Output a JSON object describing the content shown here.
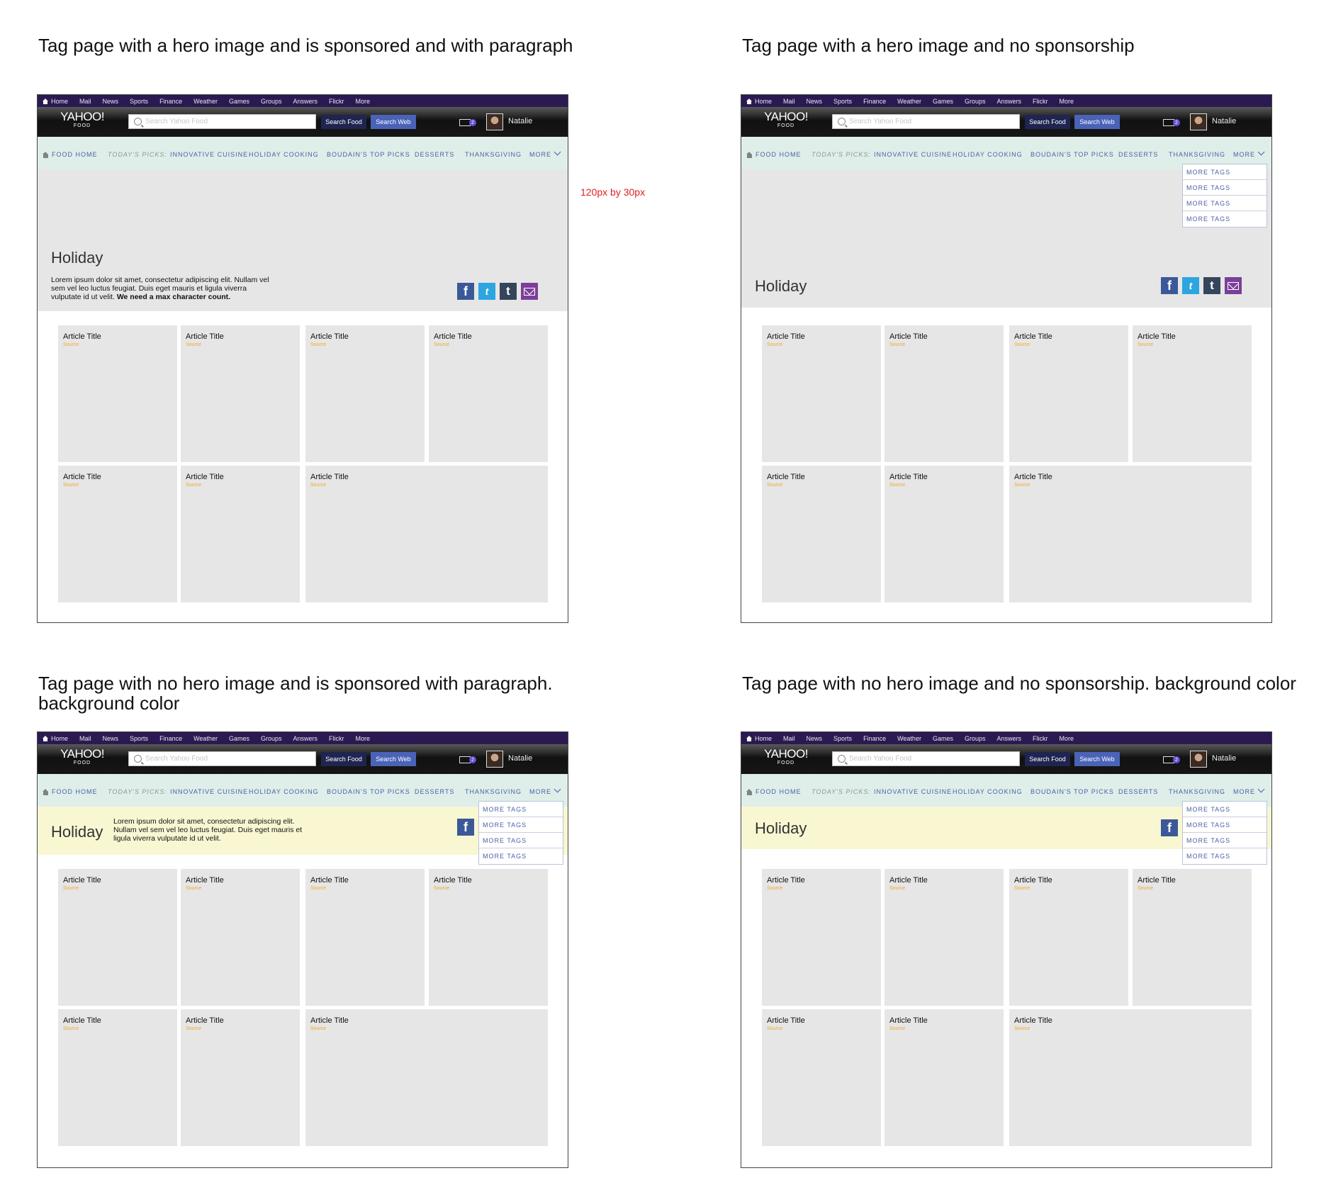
{
  "captions": {
    "p1": "Tag page with a hero image and is sponsored and with paragraph",
    "p2": "Tag page with a hero image and no sponsorship",
    "p3_line1": "Tag page with no hero image and is sponsored with paragraph.",
    "p3_line2": "background color",
    "p4": "Tag page with no hero image and no sponsorship. background color"
  },
  "note": "120px by 30px",
  "topnav": [
    "Home",
    "Mail",
    "News",
    "Sports",
    "Finance",
    "Weather",
    "Games",
    "Groups",
    "Answers",
    "Flickr",
    "More"
  ],
  "header": {
    "logo_main": "YAHOO!",
    "logo_sub": "FOOD",
    "search_placeholder": "Search Yahoo Food",
    "search_food": "Search Food",
    "search_web": "Search Web",
    "mail_count": "2",
    "user": "Natalie"
  },
  "catnav": {
    "food_home": "FOOD HOME",
    "picks": "TODAY'S PICKS:",
    "items": [
      "INNOVATIVE CUISINE",
      "HOLIDAY COOKING",
      "BOUDAIN'S TOP PICKS",
      "DESSERTS",
      "THANKSGIVING"
    ],
    "more": "MORE"
  },
  "dropdown": [
    "MORE TAGS",
    "MORE TAGS",
    "MORE TAGS",
    "MORE TAGS"
  ],
  "hero": {
    "title": "Holiday",
    "para_a_l1": "Lorem ipsum dolor sit amet, consectetur adipiscing elit. Nullam vel",
    "para_a_l2": "sem vel leo luctus feugiat. Duis eget mauris et ligula viverra",
    "para_a_l3": "vulputate id ut velit.",
    "para_a_bold": "We need a max character count.",
    "para_b_l1": "Lorem ipsum dolor sit amet, consectetur adipiscing elit.",
    "para_b_l2": "Nullam vel sem vel leo luctus feugiat. Duis eget mauris et",
    "para_b_l3": "ligula viverra vulputate id ut velit."
  },
  "cards": {
    "title": "Article Title",
    "source": "Source"
  },
  "colors": {
    "topnav": "#2b1a52",
    "catnav": "#dfeee9",
    "hero_gray": "#e6e6e6",
    "hero_yellow": "#f8f7d2",
    "card": "#e6e6e6",
    "source": "#f0a830",
    "link": "#4a5fa8"
  },
  "icons": [
    "home-icon",
    "search-icon",
    "mail-icon",
    "chevron-down-icon",
    "facebook-icon",
    "twitter-icon",
    "tumblr-icon",
    "email-icon"
  ]
}
